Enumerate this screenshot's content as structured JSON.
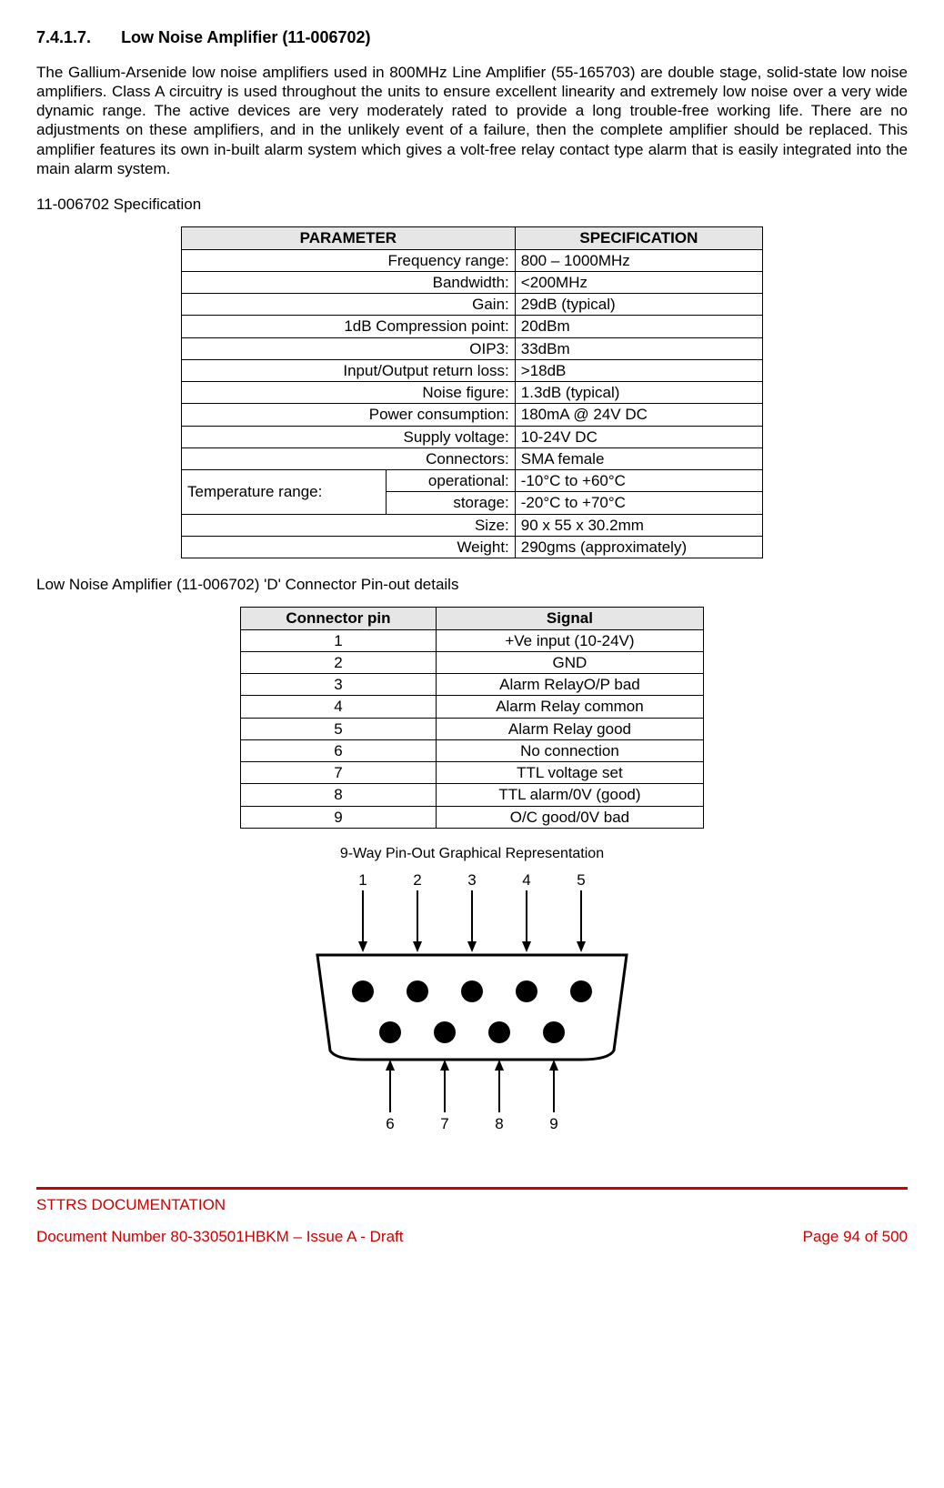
{
  "heading_number": "7.4.1.7.",
  "heading_title": "Low Noise Amplifier (11-006702)",
  "body_text": "The Gallium-Arsenide low noise amplifiers used in 800MHz Line Amplifier (55-165703) are double stage, solid-state low noise amplifiers. Class A circuitry is used throughout the units to ensure excellent linearity and extremely low noise over a very wide dynamic range. The active devices are very moderately rated to provide a long trouble-free working life. There are no adjustments on these amplifiers, and in the unlikely event of a failure, then the complete amplifier should be replaced. This amplifier features its own in-built alarm system which gives a volt-free relay contact type alarm that is easily integrated into the main alarm system.",
  "spec_title": "11-006702 Specification",
  "spec_headers": {
    "param": "PARAMETER",
    "spec": "SPECIFICATION"
  },
  "spec_rows": [
    {
      "param": "Frequency range:",
      "value": "800 – 1000MHz"
    },
    {
      "param": "Bandwidth:",
      "value": "<200MHz"
    },
    {
      "param": "Gain:",
      "value": "29dB (typical)"
    },
    {
      "param": "1dB Compression point:",
      "value": "20dBm"
    },
    {
      "param": "OIP3:",
      "value": "33dBm"
    },
    {
      "param": "Input/Output return loss:",
      "value": ">18dB"
    },
    {
      "param": "Noise figure:",
      "value": "1.3dB (typical)"
    },
    {
      "param": "Power consumption:",
      "value": "180mA @ 24V DC"
    },
    {
      "param": "Supply voltage:",
      "value": "10-24V DC"
    },
    {
      "param": "Connectors:",
      "value": "SMA female"
    }
  ],
  "temp_group_label": "Temperature range:",
  "temp_op": {
    "label": "operational:",
    "value": "-10°C to +60°C"
  },
  "temp_st": {
    "label": "storage:",
    "value": "-20°C to +70°C"
  },
  "spec_tail": [
    {
      "param": "Size:",
      "value": "90 x 55 x 30.2mm"
    },
    {
      "param": "Weight:",
      "value": "290gms (approximately)"
    }
  ],
  "pinout_title": "Low Noise Amplifier (11-006702) 'D' Connector Pin-out details",
  "pin_headers": {
    "pin": "Connector pin",
    "signal": "Signal"
  },
  "pin_rows": [
    {
      "pin": "1",
      "signal": "+Ve input (10-24V)"
    },
    {
      "pin": "2",
      "signal": "GND"
    },
    {
      "pin": "3",
      "signal": "Alarm RelayO/P bad"
    },
    {
      "pin": "4",
      "signal": "Alarm Relay common"
    },
    {
      "pin": "5",
      "signal": "Alarm Relay good"
    },
    {
      "pin": "6",
      "signal": "No connection"
    },
    {
      "pin": "7",
      "signal": "TTL voltage set"
    },
    {
      "pin": "8",
      "signal": "TTL alarm/0V (good)"
    },
    {
      "pin": "9",
      "signal": "O/C good/0V bad"
    }
  ],
  "diagram_title": "9-Way Pin-Out Graphical Representation",
  "top_labels": [
    "1",
    "2",
    "3",
    "4",
    "5"
  ],
  "bottom_labels": [
    "6",
    "7",
    "8",
    "9"
  ],
  "footer": {
    "line1": "STTRS DOCUMENTATION",
    "left": "Document Number 80-330501HBKM – Issue A - Draft",
    "right": "Page 94 of 500"
  }
}
